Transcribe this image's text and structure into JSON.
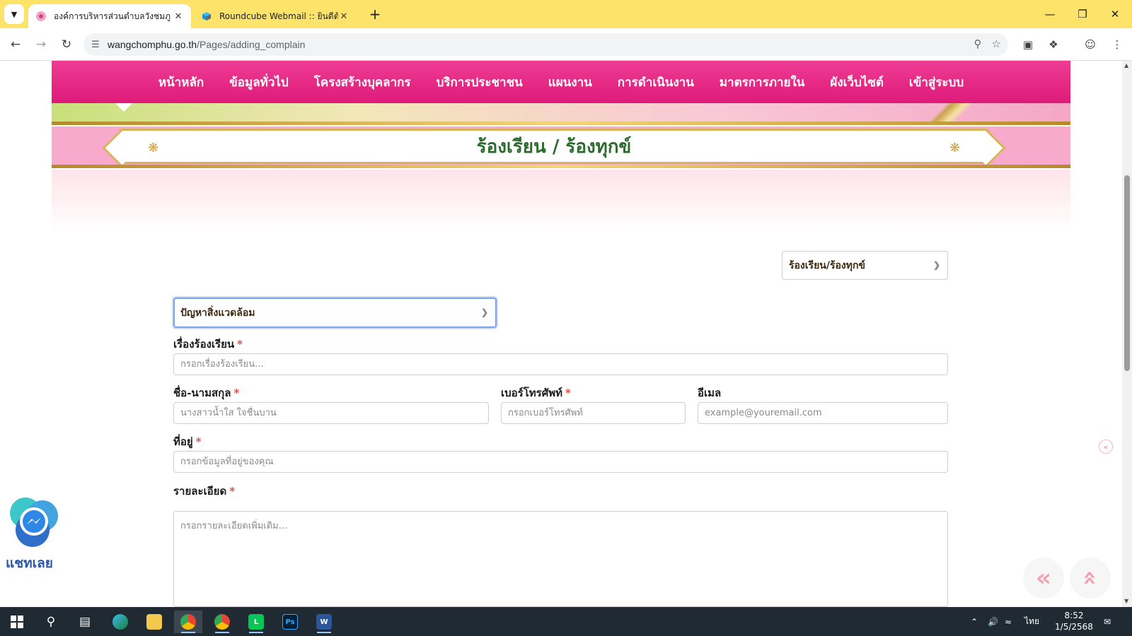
{
  "browser": {
    "tabs": [
      {
        "title": "องค์การบริหารส่วนตำบลวังชมภู",
        "active": true
      },
      {
        "title": "Roundcube Webmail :: ยินดีต้อนรับ",
        "active": false
      }
    ],
    "url_host": "wangchomphu.go.th",
    "url_path": "/Pages/adding_complain"
  },
  "nav": {
    "items": [
      "หน้าหลัก",
      "ข้อมูลทั่วไป",
      "โครงสร้างบุคลากร",
      "บริการประชาชน",
      "แผนงาน",
      "การดำเนินงาน",
      "มาตรการภายใน",
      "ผังเว็บไซต์",
      "เข้าสู่ระบบ"
    ]
  },
  "page": {
    "title": "ร้องเรียน / ร้องทุกข์"
  },
  "form": {
    "type_select": "ร้องเรียน/ร้องทุกข์",
    "category_select": "ปัญหาสิ่งแวดล้อม",
    "subject": {
      "label": "เรื่องร้องเรียน",
      "placeholder": "กรอกเรื่องร้องเรียน..."
    },
    "name": {
      "label": "ชื่อ-นามสกุล",
      "placeholder": "นางสาวน้ำใส ใจชื่นบาน"
    },
    "phone": {
      "label": "เบอร์โทรศัพท์",
      "placeholder": "กรอกเบอร์โทรศัพท์"
    },
    "email": {
      "label": "อีเมล",
      "placeholder": "example@youremail.com"
    },
    "address": {
      "label": "ที่อยู่",
      "placeholder": "กรอกข้อมูลที่อยู่ของคุณ"
    },
    "details": {
      "label": "รายละเอียด",
      "placeholder": "กรอกรายละเอียดเพิ่มเติม..."
    },
    "required_mark": "*"
  },
  "chat": {
    "label": "แชทเลย"
  },
  "taskbar": {
    "lang": "ไทย",
    "time": "8:52",
    "date": "1/5/2568"
  },
  "colors": {
    "nav_pink": "#e4217f",
    "title_green": "#2e6b2e",
    "required_red": "#e23b3b",
    "gold": "#d8b25a"
  }
}
